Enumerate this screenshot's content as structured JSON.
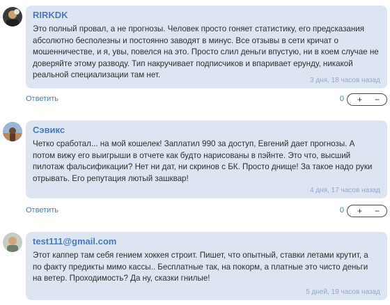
{
  "comments": [
    {
      "author": "RIRKDK",
      "text": "Это полный провал, а не прогнозы. Человек просто гоняет статистику, его предсказания абсолютно бесполезны и постоянно заводят в минус. Все отзывы в сети кричат о мошенничестве, и я, увы, повелся на это. Просто слил деньги впустую, ни в коем случае не доверяйте этому разводу. Тип накручивает подписчиков и впаривает ерунду, никакой реальной специализации там нет.",
      "date": "3 дня, 18 часов назад",
      "reply_label": "Ответить",
      "score": "0",
      "plus": "+",
      "minus": "−"
    },
    {
      "author": "Сэвикс",
      "text": "Четко сработал... на мой кошелек! Заплатил 990 за доступ, Евгений дает прогнозы. А потом вижу его выигрыши в отчете как будто нарисованы в пэйнте. Это что, высший пилотаж фальсификации? Нет ни дат, ни скринов с БК. Просто днище! За такое надо руки отрывать. Его репутация лютый зашквар!",
      "date": "4 дня, 17 часов назад",
      "reply_label": "Ответить",
      "score": "0",
      "plus": "+",
      "minus": "−"
    },
    {
      "author": "test111@gmail.com",
      "text": "Этот каппер там себя гением хоккея строит. Пишет, что опытный, ставки летами крутит, а по факту предикты мимо кассы.. Бесплатные так, на покорм, а платные это чисто деньги на ветер. Проходимость? Да ну, сказки гнилые!",
      "date": "5 дней, 19 часов назад"
    }
  ],
  "colors": {
    "bubble": "#dde5f3",
    "author": "#4a78c1",
    "date": "#93a8cf",
    "link": "#4a78c1"
  }
}
